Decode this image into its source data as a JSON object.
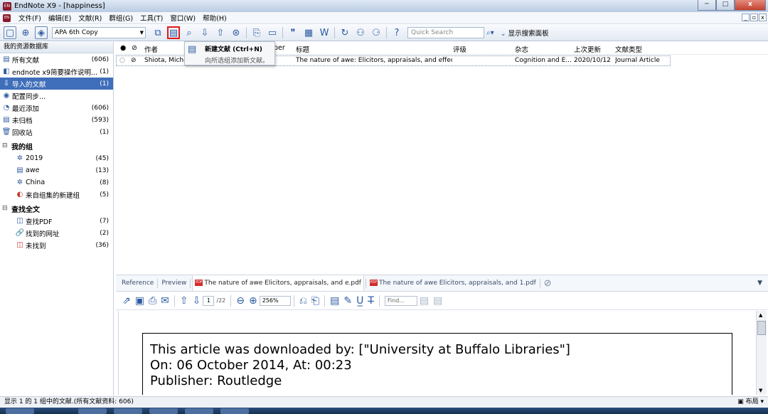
{
  "window": {
    "title": "EndNote X9 - [happiness]",
    "app_icon": "EN",
    "buttons": [
      "─",
      "□",
      "x"
    ]
  },
  "menubar": {
    "items": [
      "文件(F)",
      "编辑(E)",
      "文献(R)",
      "群组(G)",
      "工具(T)",
      "窗口(W)",
      "帮助(H)"
    ],
    "mdi_buttons": [
      "_",
      "▫",
      "x"
    ]
  },
  "toolbar": {
    "style_value": "APA 6th Copy",
    "quick_search_placeholder": "Quick Search",
    "show_panel_label": "显示搜索面板",
    "highlighted_tool": "new-reference-icon"
  },
  "tooltip": {
    "title": "新建文献 (Ctrl+N)",
    "description": "向所选组添加新文献。"
  },
  "library": {
    "header": "我的资源数据库",
    "items": [
      {
        "label": "所有文献",
        "count": "(606)",
        "icon": "all-refs-icon"
      },
      {
        "label": "endnote x9简要操作说明...",
        "count": "(1)",
        "icon": "library-icon"
      },
      {
        "label": "导入的文献",
        "count": "(1)",
        "icon": "imported-icon",
        "selected": true
      },
      {
        "label": "配置同步...",
        "count": "",
        "icon": "sync-icon"
      },
      {
        "label": "最近添加",
        "count": "(606)",
        "icon": "recent-icon"
      },
      {
        "label": "未归档",
        "count": "(593)",
        "icon": "unfiled-icon"
      },
      {
        "label": "回收站",
        "count": "(1)",
        "icon": "trash-icon"
      }
    ],
    "my_groups": {
      "title": "我的组",
      "items": [
        {
          "label": "2019",
          "count": "(45)",
          "icon": "smart-group-icon"
        },
        {
          "label": "awe",
          "count": "(13)",
          "icon": "group-icon"
        },
        {
          "label": "China",
          "count": "(8)",
          "icon": "smart-group-icon"
        },
        {
          "label": "来自组集的新建组",
          "count": "(5)",
          "icon": "combined-group-icon"
        }
      ]
    },
    "find_fulltext": {
      "title": "查找全文",
      "items": [
        {
          "label": "查找PDF",
          "count": "(7)",
          "icon": "find-pdf-icon"
        },
        {
          "label": "找到的网址",
          "count": "(2)",
          "icon": "link-icon"
        },
        {
          "label": "未找到",
          "count": "(36)",
          "icon": "not-found-icon"
        }
      ]
    }
  },
  "reference_table": {
    "columns": [
      "●",
      "作者",
      "ber",
      "标题",
      "评级",
      "杂志",
      "上次更新",
      "文献类型"
    ],
    "rows": [
      {
        "author": "Shiota, Miche",
        "title": "The nature of awe: Elicitors, appraisals, and effect...",
        "rating": "",
        "journal": "Cognition and E...",
        "updated": "2020/10/12",
        "type": "Journal Article"
      }
    ]
  },
  "tabs": {
    "items": [
      "Reference",
      "Preview",
      "The nature of awe Elicitors, appraisals, and e.pdf",
      "The nature of awe Elicitors, appraisals, and 1.pdf"
    ],
    "active": 2
  },
  "pdf_toolbar": {
    "page_value": "1",
    "page_total": "/22",
    "zoom": "256%",
    "find_placeholder": "Find..."
  },
  "pdf_content": {
    "lines": [
      "This article was downloaded by: [\"University at Buffalo Libraries\"]",
      "On: 06 October 2014, At: 00:23",
      "Publisher: Routledge"
    ]
  },
  "status": {
    "text": "显示 1 的 1 组中的文献.(所有文献资料: 606)",
    "layout_label": "布局"
  }
}
